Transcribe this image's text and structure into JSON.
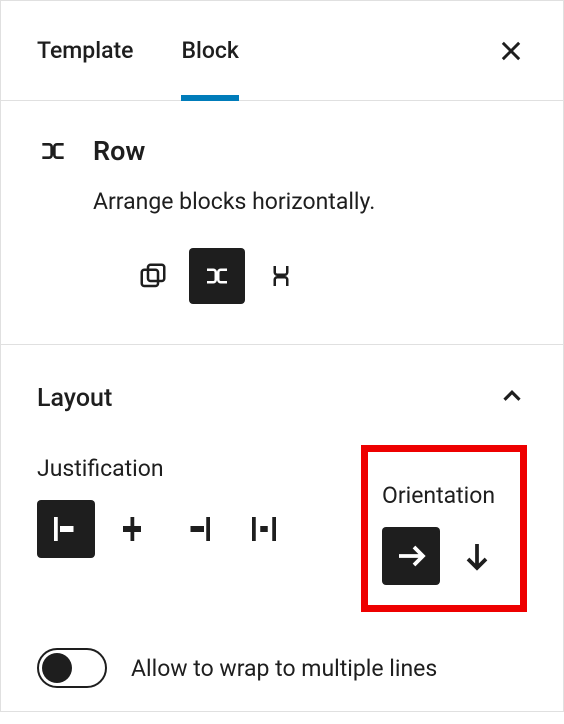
{
  "tabs": {
    "template_label": "Template",
    "block_label": "Block"
  },
  "block": {
    "title": "Row",
    "description": "Arrange blocks horizontally."
  },
  "panel": {
    "layout_label": "Layout",
    "justification_label": "Justification",
    "orientation_label": "Orientation",
    "wrap_label": "Allow to wrap to multiple lines"
  }
}
